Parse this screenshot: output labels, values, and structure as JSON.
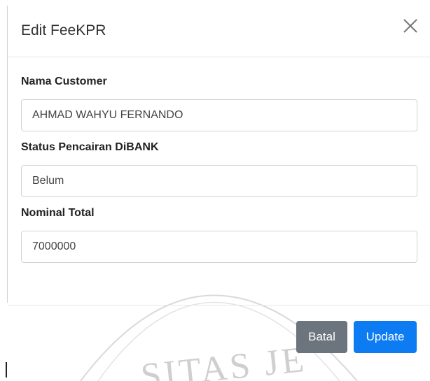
{
  "modal": {
    "title": "Edit FeeKPR",
    "close_icon": "close-icon"
  },
  "form": {
    "fields": [
      {
        "label": "Nama Customer",
        "value": "AHMAD WAHYU FERNANDO"
      },
      {
        "label": "Status Pencairan DiBANK",
        "value": "Belum"
      },
      {
        "label": "Nominal Total",
        "value": "7000000"
      }
    ]
  },
  "footer": {
    "cancel_label": "Batal",
    "update_label": "Update"
  },
  "watermark": {
    "text": "SITAS JE"
  },
  "colors": {
    "cancel": "#6c757d",
    "update": "#0d7bf2",
    "border": "#ced4da"
  }
}
